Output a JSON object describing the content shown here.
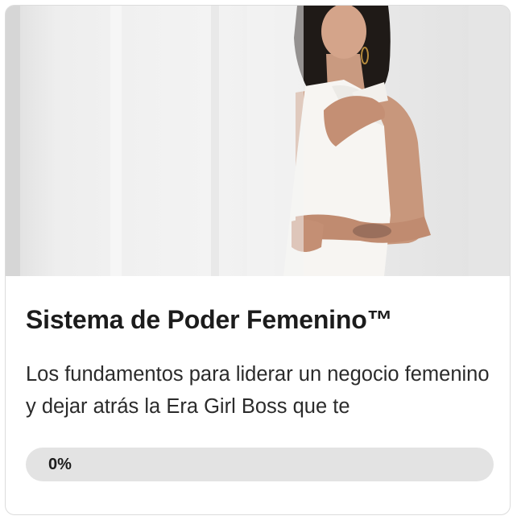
{
  "course": {
    "image_alt": "Mujer con vestido blanco junto a una cortina blanca",
    "title": "Sistema de Poder Femenino™",
    "description": "Los fundamentos para liderar un negocio femenino y dejar atrás la Era Girl Boss que te",
    "progress": {
      "label": "0%",
      "value": 0
    }
  },
  "colors": {
    "card_border": "#dcdcdc",
    "progress_track": "#e3e3e3",
    "text": "#1c1c1c"
  }
}
